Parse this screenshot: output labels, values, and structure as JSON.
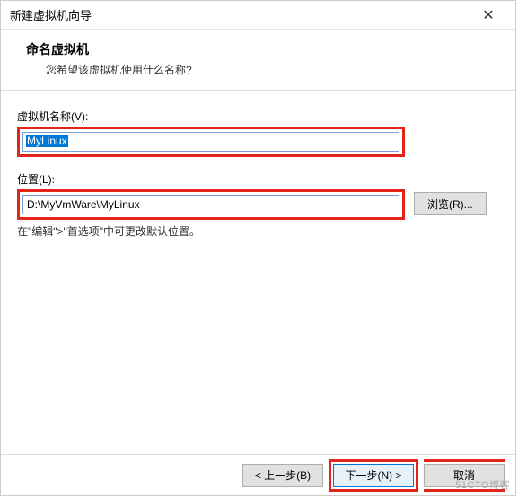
{
  "titlebar": {
    "title": "新建虚拟机向导",
    "close_glyph": "✕"
  },
  "header": {
    "title": "命名虚拟机",
    "subtitle": "您希望该虚拟机使用什么名称?"
  },
  "form": {
    "name_label": "虚拟机名称(V):",
    "name_value": "MyLinux",
    "location_label": "位置(L):",
    "location_value": "D:\\MyVmWare\\MyLinux",
    "browse_label": "浏览(R)...",
    "hint": "在\"编辑\">\"首选项\"中可更改默认位置。"
  },
  "footer": {
    "back_label": "< 上一步(B)",
    "next_label": "下一步(N) >",
    "cancel_label": "取消"
  },
  "watermark": "51CTO博客"
}
